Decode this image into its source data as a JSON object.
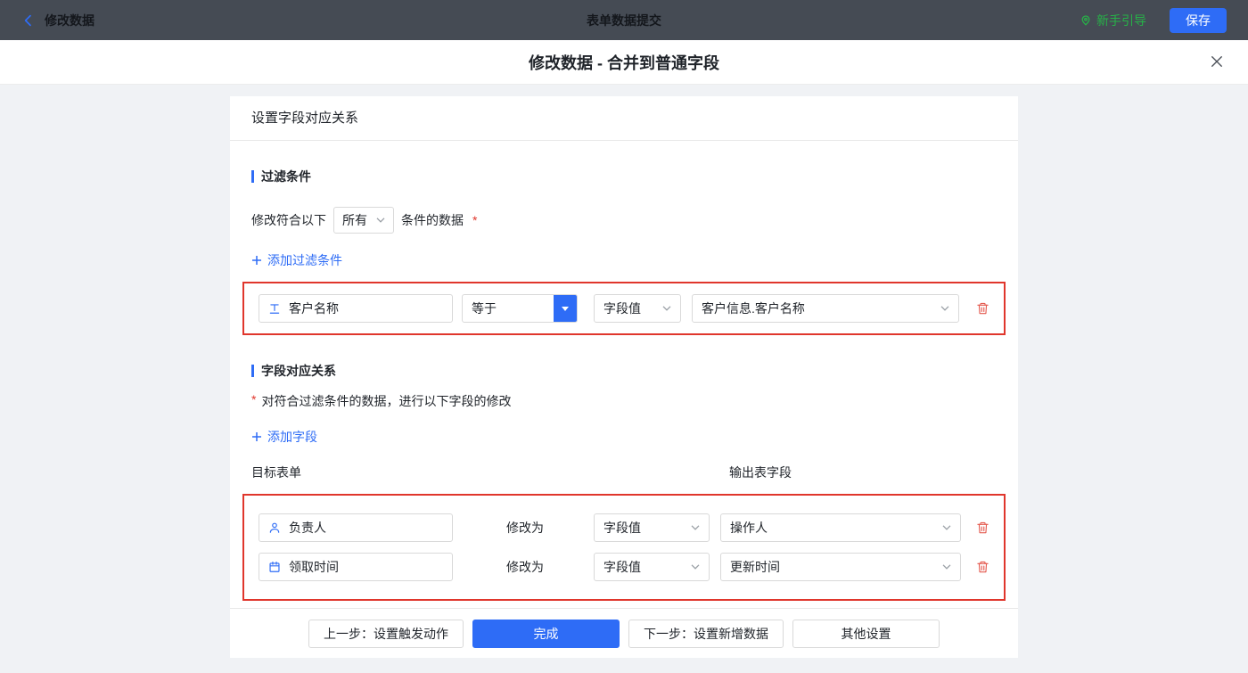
{
  "topbar": {
    "back_label": "修改数据",
    "title": "表单数据提交",
    "guide_label": "新手引导",
    "save_label": "保存"
  },
  "dialog": {
    "title": "修改数据 - 合并到普通字段"
  },
  "card": {
    "header": "设置字段对应关系",
    "filter": {
      "title": "过滤条件",
      "prefix": "修改符合以下",
      "scope_value": "所有",
      "suffix": "条件的数据",
      "required": "*",
      "add_label": "添加过滤条件",
      "rows": [
        {
          "field": "客户名称",
          "operator": "等于",
          "value_type": "字段值",
          "value": "客户信息.客户名称"
        }
      ]
    },
    "mapping": {
      "title": "字段对应关系",
      "required": "*",
      "description": "对符合过滤条件的数据，进行以下字段的修改",
      "add_label": "添加字段",
      "col_target": "目标表单",
      "col_output": "输出表字段",
      "modify_label": "修改为",
      "rows": [
        {
          "field": "负责人",
          "icon": "user-icon",
          "value_type": "字段值",
          "value": "操作人"
        },
        {
          "field": "领取时间",
          "icon": "calendar-icon",
          "value_type": "字段值",
          "value": "更新时间"
        }
      ]
    },
    "footer": {
      "prev": "上一步：设置触发动作",
      "done": "完成",
      "next": "下一步：设置新增数据",
      "other": "其他设置"
    }
  },
  "colors": {
    "accent_blue": "#2e6cf6",
    "highlight_red": "#e0362c",
    "danger_red": "#e4594e",
    "guide_green": "#27b148",
    "topbar_bg": "#454b54",
    "page_bg": "#f0f2f5"
  }
}
